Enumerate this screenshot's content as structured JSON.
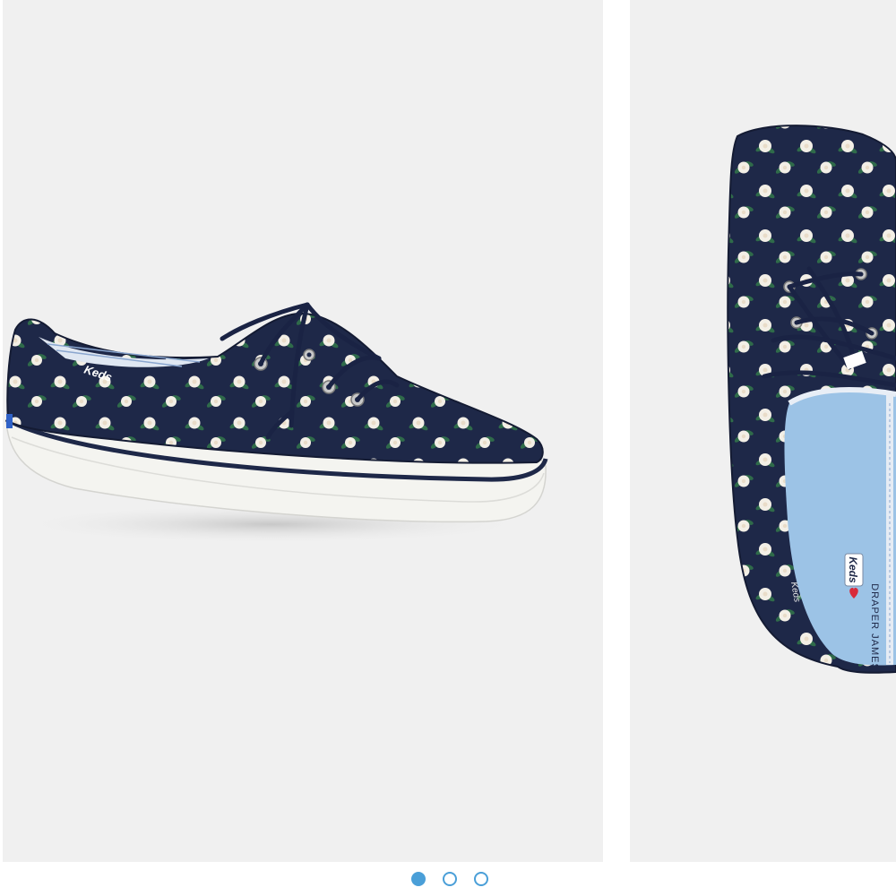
{
  "carousel": {
    "slides": [
      {
        "subject": "side-view-sneaker",
        "tongue_label": "Keds"
      },
      {
        "subject": "top-view-sneaker",
        "insole_logo": "Keds",
        "insole_collab": "DRAPER JAMES",
        "insole_script": "Keds"
      }
    ],
    "dots": [
      {
        "active": true
      },
      {
        "active": false
      },
      {
        "active": false
      }
    ],
    "active_index": 0
  },
  "colors": {
    "background": "#f0f0f0",
    "canvas_navy": "#1e2848",
    "flower_white": "#f3efe6",
    "leaf_green": "#2f6b4a",
    "sole_white": "#f4f4f0",
    "insole_blue": "#9cc3e6",
    "dot_accent": "#4a9fd8",
    "heart_red": "#d82a3a"
  }
}
